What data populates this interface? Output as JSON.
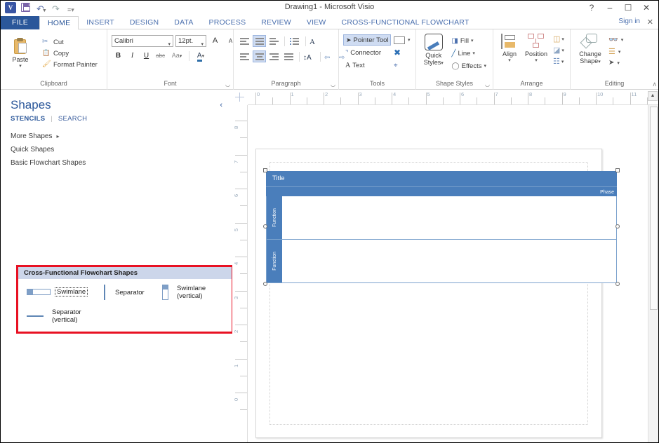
{
  "window": {
    "title": "Drawing1 - Microsoft Visio",
    "app_logo": "V",
    "quick_access": [
      {
        "name": "save-icon",
        "label": "Save"
      },
      {
        "name": "undo-icon",
        "label": "Undo"
      },
      {
        "name": "redo-icon",
        "label": "Redo"
      },
      {
        "name": "customize-qat-icon",
        "label": "Customize Quick Access Toolbar"
      }
    ],
    "controls": {
      "help": "?",
      "minimize": "–",
      "maximize": "☐",
      "close": "✕"
    },
    "sign_in": "Sign in",
    "collapse_ribbon": "✕"
  },
  "ribbon": {
    "tabs": [
      {
        "label": "FILE",
        "state": "file"
      },
      {
        "label": "HOME",
        "state": "active"
      },
      {
        "label": "INSERT",
        "state": "normal"
      },
      {
        "label": "DESIGN",
        "state": "normal"
      },
      {
        "label": "DATA",
        "state": "normal"
      },
      {
        "label": "PROCESS",
        "state": "normal"
      },
      {
        "label": "REVIEW",
        "state": "normal"
      },
      {
        "label": "VIEW",
        "state": "normal"
      },
      {
        "label": "CROSS-FUNCTIONAL FLOWCHART",
        "state": "normal"
      }
    ],
    "groups": {
      "clipboard": {
        "name": "Clipboard",
        "paste": "Paste",
        "cut": "Cut",
        "copy": "Copy",
        "format_painter": "Format Painter"
      },
      "font": {
        "name": "Font",
        "font_family": "Calibri",
        "font_size": "12pt.",
        "grow_font": "A",
        "shrink_font": "A",
        "bold": "B",
        "italic": "I",
        "underline": "U",
        "strikethrough": "abc",
        "change_case": "Aa",
        "font_color": "A"
      },
      "paragraph": {
        "name": "Paragraph"
      },
      "tools": {
        "name": "Tools",
        "pointer_tool": "Pointer Tool",
        "connector": "Connector",
        "text": "Text",
        "selected": "Pointer Tool"
      },
      "shape_styles": {
        "name": "Shape Styles",
        "quick_styles": "Quick\nStyles",
        "quick_styles_l1": "Quick",
        "quick_styles_l2": "Styles",
        "fill": "Fill",
        "line": "Line",
        "effects": "Effects"
      },
      "arrange": {
        "name": "Arrange",
        "align": "Align",
        "position": "Position",
        "bring_forward": "Bring Forward",
        "send_backward": "Send Backward",
        "group": "Group"
      },
      "editing": {
        "name": "Editing",
        "change_shape_l1": "Change",
        "change_shape_l2": "Shape",
        "find": "Find",
        "layers": "Layers",
        "select": "Select",
        "collapse": "∧"
      }
    }
  },
  "shapes_pane": {
    "title": "Shapes",
    "collapse": "‹",
    "tabs": [
      {
        "label": "STENCILS",
        "active": true
      },
      {
        "label": "SEARCH",
        "active": false
      }
    ],
    "divider": "|",
    "rows": [
      {
        "label": "More Shapes",
        "arrow": "▸"
      },
      {
        "label": "Quick Shapes",
        "arrow": ""
      },
      {
        "label": "Basic Flowchart Shapes",
        "arrow": ""
      }
    ],
    "stencil": {
      "header": "Cross-Functional Flowchart Shapes",
      "highlighted": true,
      "items": [
        {
          "label": "Swimlane",
          "icon": "swimlane-icon",
          "selected": true
        },
        {
          "label": "Separator",
          "icon": "separator-icon",
          "selected": false
        },
        {
          "label": "Swimlane (vertical)",
          "line1": "Swimlane",
          "line2": "(vertical)",
          "icon": "swimlane-vertical-icon",
          "selected": false
        },
        {
          "label": "Separator (vertical)",
          "line1": "Separator",
          "line2": "(vertical)",
          "icon": "separator-vertical-icon",
          "selected": false
        }
      ]
    }
  },
  "drawing": {
    "ruler_h": [
      "0",
      "1",
      "2",
      "3",
      "4",
      "5",
      "6",
      "7",
      "8",
      "9",
      "10",
      "11"
    ],
    "ruler_v": [
      "8",
      "7",
      "6",
      "5",
      "4",
      "3",
      "2",
      "1",
      "0"
    ],
    "scroll_up": "▲",
    "diagram": {
      "title": "Title",
      "phase": "Phase",
      "lanes": [
        {
          "label": "Function"
        },
        {
          "label": "Function"
        }
      ],
      "selected": true,
      "accent_color": "#4a7ebb"
    }
  }
}
